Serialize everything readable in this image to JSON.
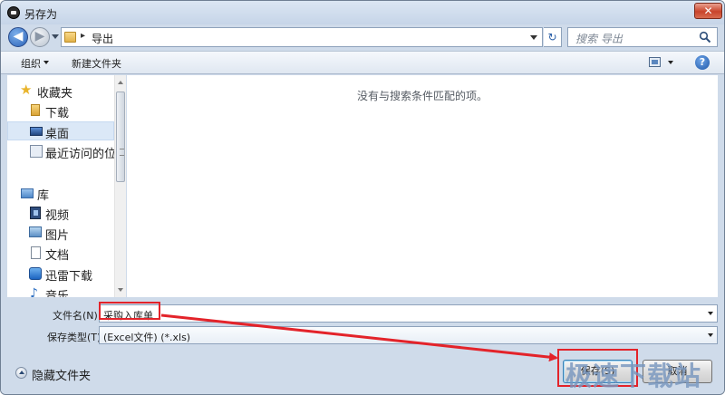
{
  "window": {
    "title": "另存为",
    "close_label": "✕"
  },
  "nav": {
    "back_glyph": "◀",
    "forward_glyph": "▶",
    "breadcrumb_separator": "▸",
    "current_folder": "导出",
    "refresh_glyph": "↻",
    "search_placeholder": "搜索 导出"
  },
  "toolbar": {
    "organize_label": "组织",
    "new_folder_label": "新建文件夹",
    "help_label": "?"
  },
  "sidebar": {
    "items": [
      {
        "label": "收藏夹",
        "icon": "star-icon"
      },
      {
        "label": "下载",
        "icon": "download-folder-icon"
      },
      {
        "label": "桌面",
        "icon": "desktop-icon"
      },
      {
        "label": "最近访问的位",
        "icon": "recent-places-icon"
      },
      {
        "label": "库",
        "icon": "library-icon"
      },
      {
        "label": "视频",
        "icon": "video-icon"
      },
      {
        "label": "图片",
        "icon": "picture-icon"
      },
      {
        "label": "文档",
        "icon": "document-icon"
      },
      {
        "label": "迅雷下载",
        "icon": "thunder-icon"
      },
      {
        "label": "音乐",
        "icon": "music-icon"
      }
    ]
  },
  "file_list": {
    "empty_message": "没有与搜索条件匹配的项。"
  },
  "form": {
    "filename_label": "文件名(N):",
    "filename_value": "采购入库单",
    "filetype_label": "保存类型(T):",
    "filetype_value": "(Excel文件) (*.xls)"
  },
  "footer": {
    "hide_folders_label": "隐藏文件夹",
    "save_label": "保存(S)",
    "cancel_label": "取消"
  },
  "annotation": {
    "color": "#e3232a"
  },
  "watermark": {
    "text": "极速下载站"
  }
}
